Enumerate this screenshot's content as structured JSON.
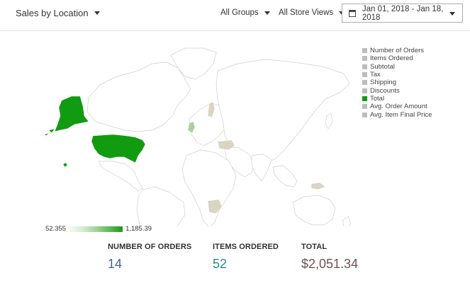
{
  "header": {
    "report_title": "Sales by Location",
    "group_filter": "All Groups",
    "store_filter": "All Store Views",
    "date_range": "Jan 01, 2018 - Jan 18, 2018"
  },
  "legend": {
    "items": [
      {
        "label": "Number of Orders",
        "active": false
      },
      {
        "label": "Items Ordered",
        "active": false
      },
      {
        "label": "Subtotal",
        "active": false
      },
      {
        "label": "Tax",
        "active": false
      },
      {
        "label": "Shipping",
        "active": false
      },
      {
        "label": "Discounts",
        "active": false
      },
      {
        "label": "Total",
        "active": true
      },
      {
        "label": "Avg. Order Amount",
        "active": false
      },
      {
        "label": "Avg. Item Final Price",
        "active": false
      }
    ]
  },
  "color_scale": {
    "min": "52.355",
    "max": "1,185.39"
  },
  "map": {
    "highlighted_regions": [
      {
        "region": "United States",
        "level": "max"
      },
      {
        "region": "United Kingdom",
        "level": "low"
      },
      {
        "region": "Sweden",
        "level": "min"
      },
      {
        "region": "Eastern Europe",
        "level": "min"
      },
      {
        "region": "South Africa",
        "level": "min"
      },
      {
        "region": "Papua New Guinea",
        "level": "min"
      }
    ],
    "colors": {
      "max": "#119b11",
      "low": "#a8cf9c",
      "min": "#d8d6c2",
      "base": "#ffffff",
      "border": "#cfcfcf"
    }
  },
  "stats": {
    "orders": {
      "label": "NUMBER OF ORDERS",
      "value": "14"
    },
    "items": {
      "label": "ITEMS ORDERED",
      "value": "52"
    },
    "total": {
      "label": "TOTAL",
      "value": "$2,051.34"
    }
  }
}
